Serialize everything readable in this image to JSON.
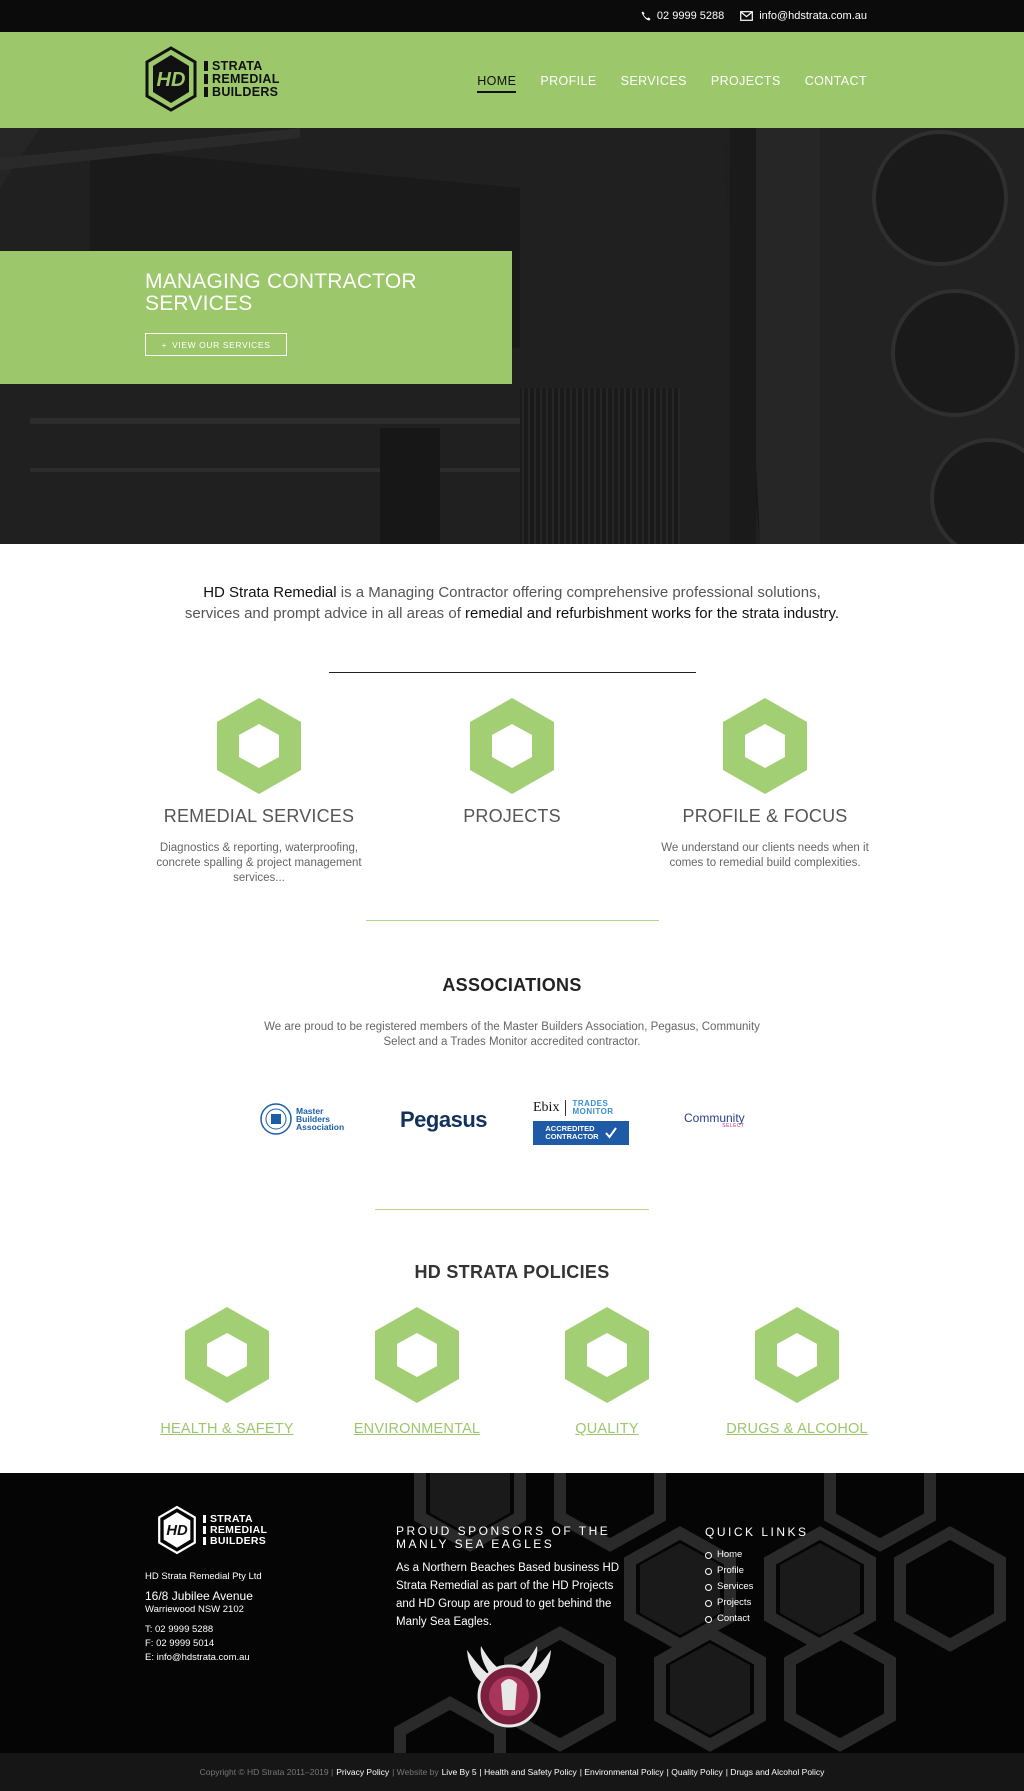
{
  "topbar": {
    "phone": "02 9999 5288",
    "email": "info@hdstrata.com.au"
  },
  "header": {
    "logo_mark": "HD",
    "logo_lines": [
      "STRATA",
      "REMEDIAL",
      "BUILDERS"
    ],
    "nav": [
      {
        "label": "HOME",
        "active": true
      },
      {
        "label": "PROFILE"
      },
      {
        "label": "SERVICES"
      },
      {
        "label": "PROJECTS"
      },
      {
        "label": "CONTACT"
      }
    ]
  },
  "hero": {
    "title": "MANAGING CONTRACTOR SERVICES",
    "button_label": "VIEW OUR SERVICES"
  },
  "intro": {
    "part1": "HD Strata Remedial",
    "part2": " is a Managing Contractor offering comprehensive professional solutions,",
    "part3": "services and prompt advice in all areas of ",
    "part4": "remedial and refurbishment works for the strata industry."
  },
  "features": [
    {
      "title": "REMEDIAL SERVICES",
      "text": "Diagnostics & reporting, waterproofing, concrete spalling & project management services..."
    },
    {
      "title": "PROJECTS",
      "text": ""
    },
    {
      "title": "PROFILE & FOCUS",
      "text": "We understand our clients needs when it comes to remedial build complexities."
    }
  ],
  "associations": {
    "title": "ASSOCIATIONS",
    "text": "We are proud to be registered members of the Master Builders Association, Pegasus, Community Select and a Trades Monitor accredited contractor.",
    "logos": {
      "mba": [
        "Master",
        "Builders",
        "Association"
      ],
      "pegasus": "Pegasus",
      "ebix": "Ebix",
      "trades_monitor": [
        "TRADES",
        "MONITOR"
      ],
      "accredited": [
        "ACCREDITED",
        "CONTRACTOR"
      ],
      "community": "Community",
      "community_sub": "SELECT"
    }
  },
  "policies": {
    "title": "HD STRATA POLICIES",
    "items": [
      "HEALTH & SAFETY",
      "ENVIRONMENTAL",
      "QUALITY",
      "DRUGS & ALCOHOL"
    ]
  },
  "footer": {
    "company": "HD Strata Remedial Pty Ltd",
    "address1": "16/8 Jubilee Avenue",
    "address2": "Warriewood NSW 2102",
    "phone": "T: 02 9999 5288",
    "fax": "F: 02 9999 5014",
    "email": "E: info@hdstrata.com.au",
    "sponsor_title": "PROUD SPONSORS OF THE MANLY SEA EAGLES",
    "sponsor_text": "As a Northern Beaches Based business HD Strata Remedial as part of the HD Projects and HD Group are proud to get behind the Manly Sea Eagles.",
    "quick_links_title": "QUICK LINKS",
    "quick_links": [
      "Home",
      "Profile",
      "Services",
      "Projects",
      "Contact"
    ]
  },
  "bottombar": {
    "copyright": "Copyright © HD Strata 2011–2019 |",
    "privacy": "Privacy Policy",
    "sep1": "| Website by",
    "liveby5": "Live By 5",
    "health": "| Health and Safety Policy",
    "env": "| Environmental Policy",
    "quality": "| Quality Policy",
    "drugs": "| Drugs and Alcohol Policy"
  },
  "colors": {
    "brand_green": "#9cc76a",
    "topbar_bg": "#0b0b0b",
    "footer_bg": "#050505"
  }
}
